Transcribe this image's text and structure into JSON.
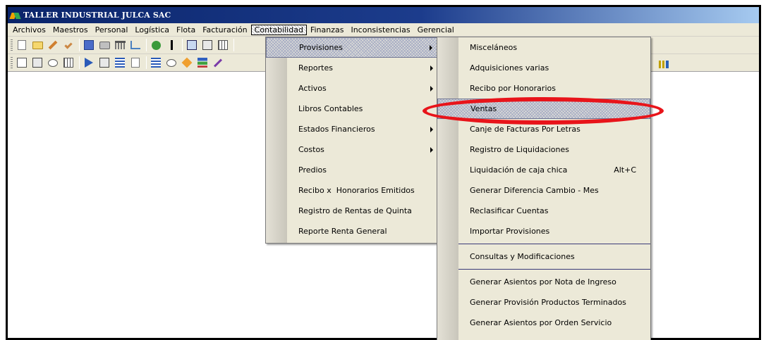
{
  "window": {
    "title": "TALLER INDUSTRIAL JULCA SAC"
  },
  "menubar": {
    "items": [
      "Archivos",
      "Maestros",
      "Personal",
      "Logística",
      "Flota",
      "Facturación",
      "Contabilidad",
      "Finanzas",
      "Inconsistencias",
      "Gerencial"
    ],
    "active": "Contabilidad"
  },
  "contabilidad_menu": {
    "items": [
      {
        "label": "Provisiones",
        "submenu": true,
        "highlighted": true
      },
      {
        "label": "Reportes",
        "submenu": true
      },
      {
        "label": "Activos",
        "submenu": true
      },
      {
        "label": "Libros Contables",
        "submenu": false
      },
      {
        "label": "Estados Financieros",
        "submenu": true
      },
      {
        "label": "Costos",
        "submenu": true
      },
      {
        "label": "Predios",
        "submenu": false
      },
      {
        "label": "Recibo x  Honorarios Emitidos",
        "submenu": false
      },
      {
        "label": "Registro de Rentas de Quinta",
        "submenu": false
      },
      {
        "label": "Reporte Renta General",
        "submenu": false
      }
    ]
  },
  "provisiones_menu": {
    "items": [
      {
        "label": "Misceláneos"
      },
      {
        "label": "Adquisiciones varias"
      },
      {
        "label": "Recibo por Honorarios"
      },
      {
        "label": "Ventas",
        "highlighted": true
      },
      {
        "label": "Canje de Facturas Por Letras"
      },
      {
        "label": "Registro de Liquidaciones"
      },
      {
        "label": "Liquidación de caja chica",
        "shortcut": "Alt+C"
      },
      {
        "label": "Generar Diferencia Cambio - Mes"
      },
      {
        "label": "Reclasificar Cuentas"
      },
      {
        "label": "Importar Provisiones"
      },
      {
        "label": "Consultas y Modificaciones"
      },
      {
        "label": "Generar Asientos por Nota de Ingreso"
      },
      {
        "label": "Generar Provisión Productos Terminados"
      },
      {
        "label": "Generar Asientos por Orden Servicio"
      }
    ]
  },
  "toolbar1": {
    "icons": [
      "new-doc-icon",
      "open-folder-icon",
      "edit-pencil-icon",
      "check-icon",
      "save-icon",
      "print-icon",
      "bank-icon",
      "tree-icon",
      "money-bag-icon",
      "runner-icon",
      "box-icon",
      "calendar-icon",
      "grid-icon"
    ]
  },
  "toolbar2": {
    "icons": [
      "chart-icon",
      "stamp-icon",
      "link-icon",
      "table-icon",
      "import-icon",
      "form-icon",
      "list-icon",
      "formula-icon",
      "rows-icon",
      "chat-icon",
      "cube-icon",
      "stack-icon",
      "wand-icon"
    ]
  },
  "annotation": {
    "color": "#e8141a",
    "target": "Ventas"
  }
}
